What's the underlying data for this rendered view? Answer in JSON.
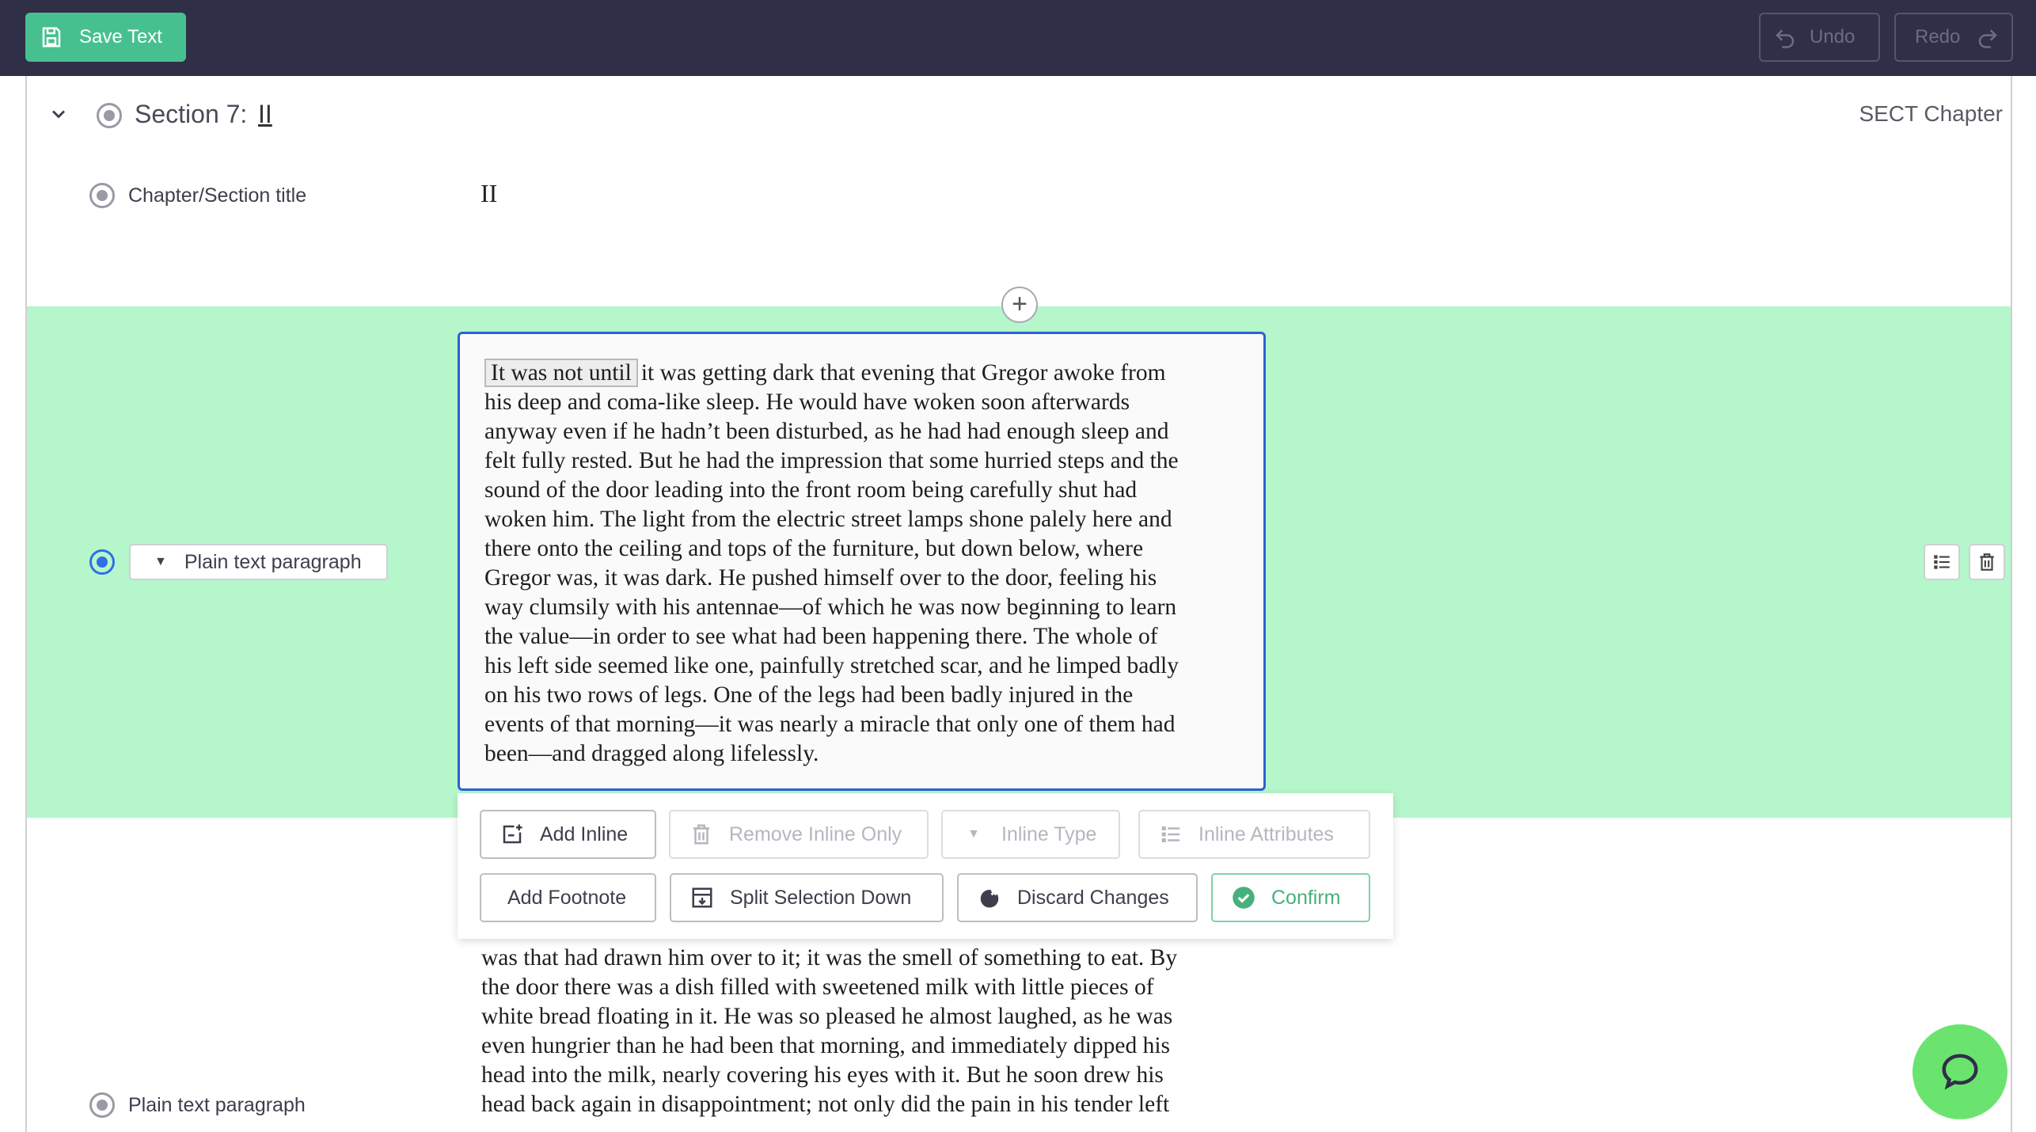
{
  "toolbar": {
    "save_label": "Save Text",
    "undo_label": "Undo",
    "redo_label": "Redo"
  },
  "section": {
    "title_prefix": "Section 7:",
    "number": "II",
    "type_label": "SECT Chapter"
  },
  "chapter_row": {
    "label": "Chapter/Section title",
    "value": "II"
  },
  "active_row": {
    "type_select": "Plain text paragraph",
    "selected_text": "It was not until",
    "paragraph_text": "it was getting dark that evening that Gregor awoke from\nhis deep and coma-like sleep. He would have woken soon afterwards\nanyway even if he hadn’t been disturbed, as he had had enough sleep and\nfelt fully rested. But he had the impression that some hurried steps and the\nsound of the door leading into the front room being carefully shut had\nwoken him. The light from the electric street lamps shone palely here and\nthere onto the ceiling and tops of the furniture, but down below, where\nGregor was, it was dark. He pushed himself over to the door, feeling his\nway clumsily with his antennae—of which he was now beginning to learn\nthe value—in order to see what had been happening there. The whole of\nhis left side seemed like one, painfully stretched scar, and he limped badly\non his two rows of legs. One of the legs had been badly injured in the\nevents of that morning—it was nearly a miracle that only one of them had\nbeen—and dragged along lifelessly."
  },
  "inline_toolbar": {
    "add_inline": "Add Inline",
    "remove_inline_only": "Remove Inline Only",
    "inline_type": "Inline Type",
    "inline_attributes": "Inline Attributes",
    "add_footnote": "Add Footnote",
    "split_selection_down": "Split Selection Down",
    "discard_changes": "Discard Changes",
    "confirm": "Confirm"
  },
  "next_row": {
    "label": "Plain text paragraph",
    "text": "was that had drawn him over to it; it was the smell of something to eat. By\nthe door there was a dish filled with sweetened milk with little pieces of\nwhite bread floating in it. He was so pleased he almost laughed, as he was\neven hungrier than he had been that morning, and immediately dipped his\nhead into the milk, nearly covering his eyes with it. But he soon drew his\nhead back again in disappointment; not only did the pain in his tender left"
  },
  "colors": {
    "topbar": "#2f2f48",
    "save_button": "#47c08f",
    "active_row": "#b5f7ca",
    "editor_border": "#2a62d8",
    "chat_button": "#6be46f"
  }
}
